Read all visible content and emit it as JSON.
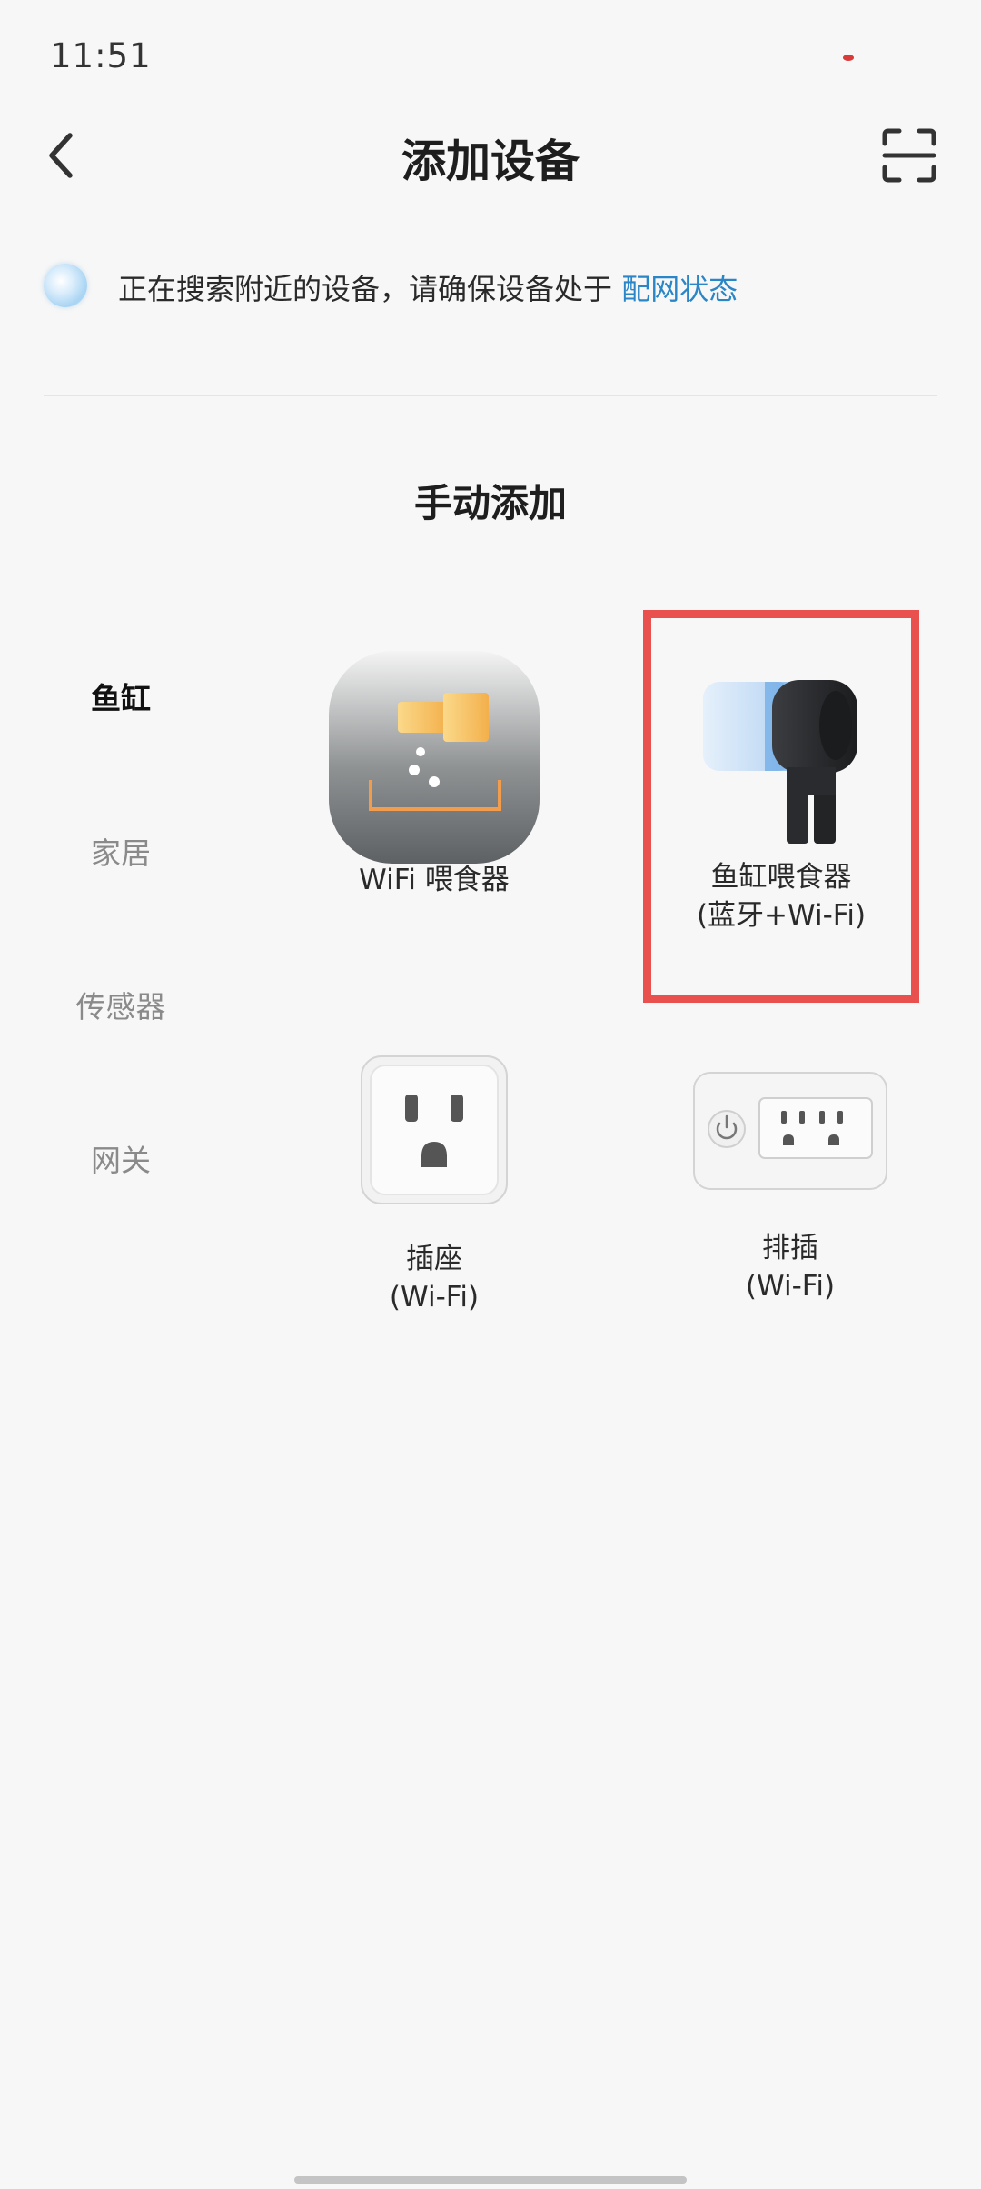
{
  "status_bar": {
    "time": "11:51"
  },
  "header": {
    "title": "添加设备",
    "back_icon": "chevron-left-icon",
    "scan_icon": "scan-frame-icon"
  },
  "search_notice": {
    "text": "正在搜索附近的设备，请确保设备处于 ",
    "link": "配网状态",
    "link_color": "#2a86c6"
  },
  "section": {
    "title": "手动添加"
  },
  "categories": [
    {
      "label": "鱼缸",
      "active": true
    },
    {
      "label": "家居",
      "active": false
    },
    {
      "label": "传感器",
      "active": false
    },
    {
      "label": "网关",
      "active": false
    }
  ],
  "devices": [
    {
      "line1": "WiFi 喂食器",
      "line2": "",
      "icon": "wifi-feeder-icon"
    },
    {
      "line1": "鱼缸喂食器",
      "line2": "(蓝牙+Wi-Fi)",
      "icon": "aquarium-feeder-icon"
    },
    {
      "line1": "插座",
      "line2": "(Wi-Fi)",
      "icon": "socket-icon"
    },
    {
      "line1": "排插",
      "line2": "(Wi-Fi)",
      "icon": "power-strip-icon"
    }
  ],
  "colors": {
    "highlight": "#e8514d",
    "background": "#f7f7f7"
  }
}
